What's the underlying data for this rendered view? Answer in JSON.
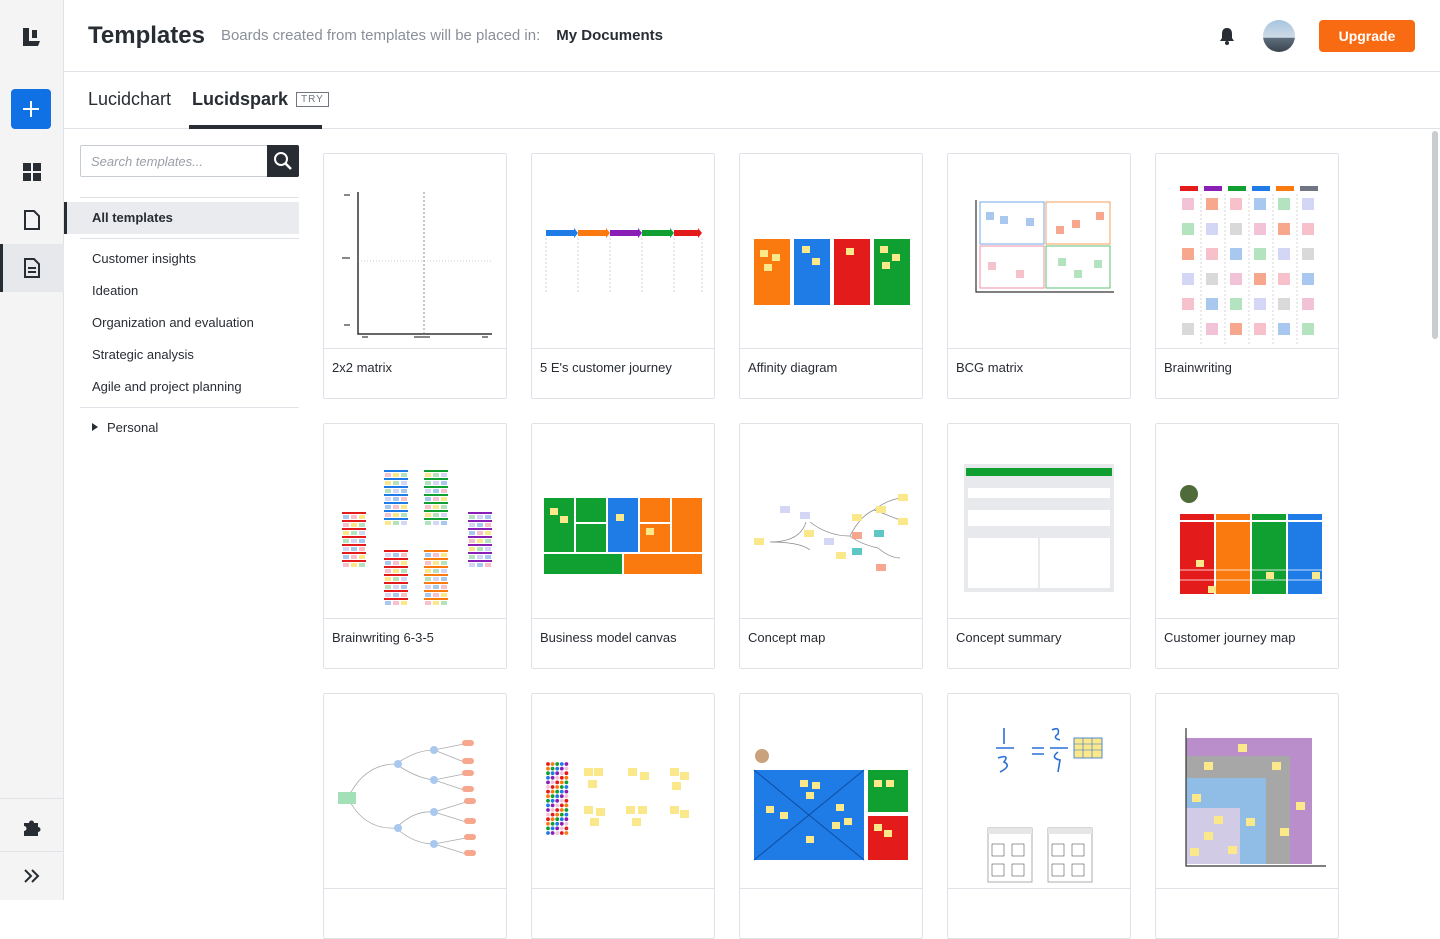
{
  "header": {
    "title": "Templates",
    "note": "Boards created from templates will be placed in:",
    "folder": "My Documents",
    "upgrade_label": "Upgrade"
  },
  "tabs": [
    {
      "label": "Lucidchart",
      "active": false
    },
    {
      "label": "Lucidspark",
      "active": true,
      "badge": "TRY"
    }
  ],
  "search": {
    "placeholder": "Search templates..."
  },
  "sidebar": {
    "all_label": "All templates",
    "categories": [
      "Customer insights",
      "Ideation",
      "Organization and evaluation",
      "Strategic analysis",
      "Agile and project planning"
    ],
    "personal_label": "Personal"
  },
  "templates": [
    {
      "name": "2x2 matrix"
    },
    {
      "name": "5 E's customer journey"
    },
    {
      "name": "Affinity diagram"
    },
    {
      "name": "BCG matrix"
    },
    {
      "name": "Brainwriting"
    },
    {
      "name": "Brainwriting 6-3-5"
    },
    {
      "name": "Business model canvas"
    },
    {
      "name": "Concept map"
    },
    {
      "name": "Concept summary"
    },
    {
      "name": "Customer journey map"
    },
    {
      "name": ""
    },
    {
      "name": ""
    },
    {
      "name": ""
    },
    {
      "name": ""
    },
    {
      "name": ""
    }
  ],
  "colors": {
    "accent": "#1071e5",
    "upgrade": "#f96b13",
    "dark": "#282c33",
    "sticky": "#fbe88a",
    "orange": "#fa7a0f",
    "blue": "#1f7be6",
    "red": "#e31b1b",
    "green": "#10a032"
  },
  "icons": [
    "lucid-logo-icon",
    "plus-icon",
    "dashboard-icon",
    "document-icon",
    "templates-icon",
    "puzzle-icon",
    "expand-icon",
    "bell-icon",
    "search-icon",
    "caret-right-icon"
  ]
}
